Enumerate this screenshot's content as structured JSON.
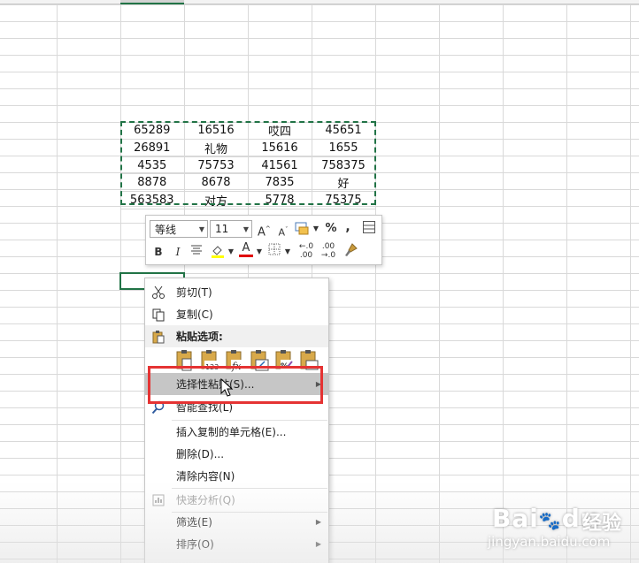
{
  "sheet": {
    "rows": [
      [
        "65289",
        "16516",
        "哎四",
        "45651"
      ],
      [
        "26891",
        "礼物",
        "15616",
        "1655"
      ],
      [
        "4535",
        "75753",
        "41561",
        "758375"
      ],
      [
        "8878",
        "8678",
        "7835",
        "好"
      ],
      [
        "563583",
        "对方",
        "5778",
        "75375"
      ]
    ]
  },
  "mini_toolbar": {
    "font_name": "等线",
    "font_size": "11",
    "percent": "%",
    "comma": ",",
    "bold": "B",
    "italic": "I",
    "font_color": "A",
    "highlight_color": "#ffff00",
    "font_color_value": "#e00000"
  },
  "context_menu": {
    "cut": "剪切(T)",
    "copy": "复制(C)",
    "paste_options": "粘贴选项:",
    "paste_special": "选择性粘贴(S)...",
    "smart_lookup": "智能查找(L)",
    "insert_copied": "插入复制的单元格(E)...",
    "delete": "删除(D)...",
    "clear_contents": "清除内容(N)",
    "quick_analysis": "快速分析(Q)",
    "filter": "筛选(E)",
    "sort": "排序(O)"
  },
  "watermark": {
    "brand": "Bai",
    "brand_suffix": "du",
    "cn": "经验",
    "url": "jingyan.baidu.com"
  },
  "colors": {
    "accent": "#217346",
    "highlight_box": "#e53333"
  }
}
